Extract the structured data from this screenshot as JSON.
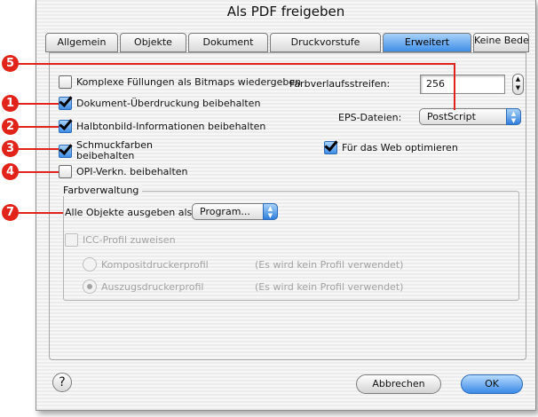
{
  "window": {
    "title": "Als PDF freigeben"
  },
  "tabs": [
    {
      "label": "Allgemein"
    },
    {
      "label": "Objekte"
    },
    {
      "label": "Dokument"
    },
    {
      "label": "Druckvorstufe"
    },
    {
      "label": "Erweitert",
      "active": true
    },
    {
      "label": "Keine Bedenken"
    }
  ],
  "options": {
    "complex_fills": {
      "label": "Komplexe Füllungen als Bitmaps wiedergeben",
      "checked": false
    },
    "overprint": {
      "label": "Dokument-Überdruckung beibehalten",
      "checked": true
    },
    "halftone": {
      "label": "Halbtonbild-Informationen beibehalten",
      "checked": true
    },
    "spot_colors": {
      "label_line1": "Schmuckfarben",
      "label_line2": "beibehalten",
      "checked": true
    },
    "opi": {
      "label": "OPI-Verkn. beibehalten",
      "checked": false
    }
  },
  "gradient": {
    "label": "Farbverlaufsstreifen:",
    "value": "256"
  },
  "eps": {
    "label": "EPS-Dateien:",
    "value": "PostScript"
  },
  "web_optimize": {
    "label": "Für das Web optimieren",
    "checked": true
  },
  "color_management": {
    "group_label": "Farbverwaltung",
    "output_label": "Alle Objekte ausgeben als:",
    "output_value": "Program...",
    "icc_label": "ICC-Profil zuweisen",
    "composite_label": "Kompositdruckerprofil",
    "composite_note": "(Es wird kein Profil verwendet)",
    "separation_label": "Auszugsdruckerprofil",
    "separation_note": "(Es wird kein Profil verwendet)"
  },
  "buttons": {
    "help": "?",
    "cancel": "Abbrechen",
    "ok": "OK"
  },
  "callouts": [
    "1",
    "2",
    "3",
    "4",
    "5",
    "7"
  ],
  "colors": {
    "callout": "#e2231a",
    "accent": "#3f8ee6"
  }
}
